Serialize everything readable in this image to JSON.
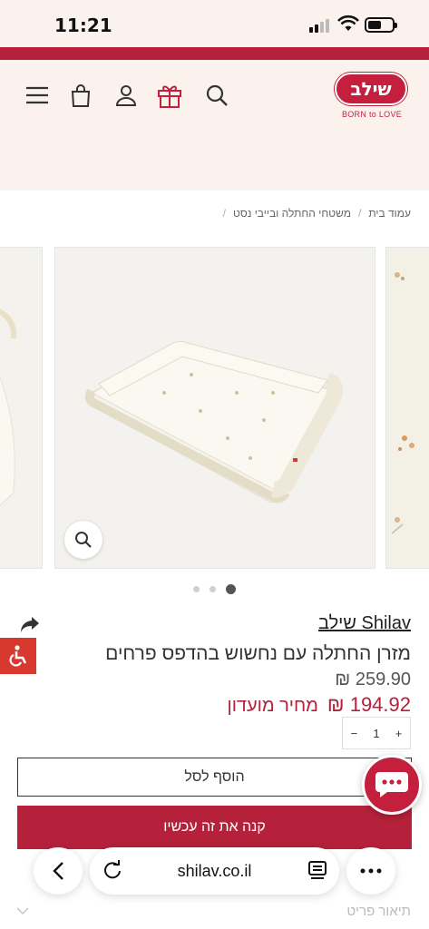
{
  "status_bar": {
    "time": "11:21"
  },
  "header": {
    "logo_text": "שילב",
    "logo_tagline": "BORN to LOVE",
    "icons": [
      "menu-icon",
      "bag-icon",
      "user-icon",
      "gift-icon",
      "search-icon"
    ]
  },
  "breadcrumb": {
    "items": [
      "עמוד בית",
      "משטחי החתלה ובייבי נסט"
    ],
    "separator": "/"
  },
  "gallery": {
    "slide_count": 3,
    "active_index": 0
  },
  "product": {
    "brand": "Shilav שילב",
    "title": "מזרן החתלה עם נחשוש בהדפס פרחים",
    "price_regular": "259.90 ₪",
    "price_club_amount": "194.92 ₪",
    "price_club_label": "מחיר מועדון",
    "quantity": "1",
    "qty_minus": "−",
    "qty_plus": "+"
  },
  "actions": {
    "add_to_cart": "הוסף לסל",
    "buy_now": "קנה את זה עכשיו"
  },
  "browser": {
    "url": "shilav.co.il"
  },
  "sections": {
    "description": "תיאור פריט"
  },
  "colors": {
    "brand_red": "#b5213a",
    "header_bg": "#fbf2ee"
  }
}
